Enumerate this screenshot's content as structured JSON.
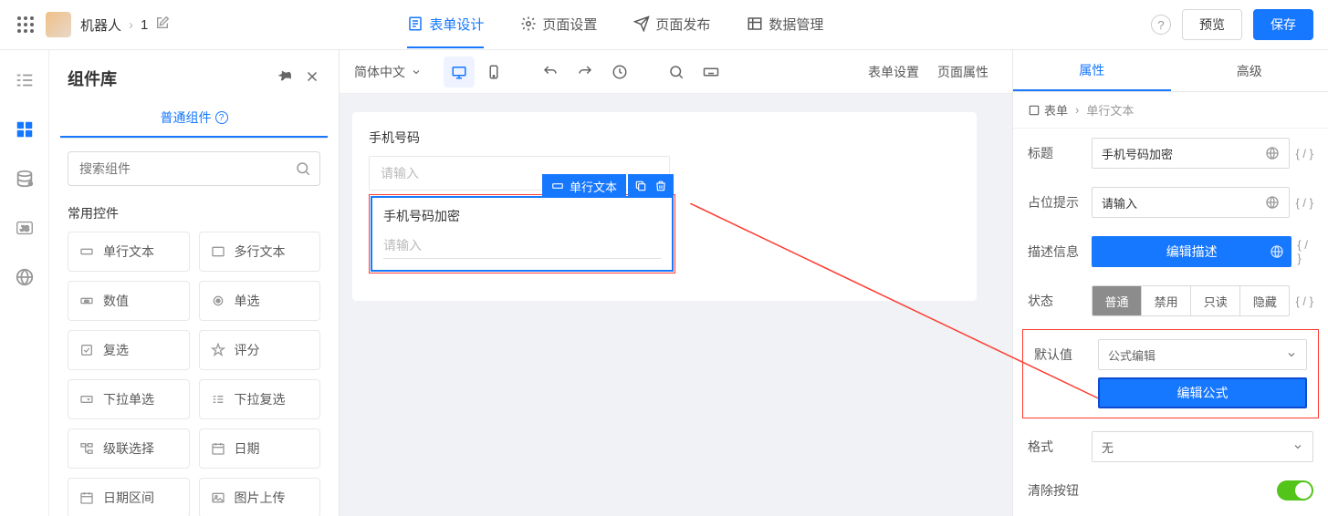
{
  "header": {
    "app_name": "机器人",
    "page_num": "1",
    "tabs": {
      "form_design": "表单设计",
      "page_settings": "页面设置",
      "page_publish": "页面发布",
      "data_manage": "数据管理"
    },
    "preview": "预览",
    "save": "保存"
  },
  "sidebar": {
    "title": "组件库",
    "tab": "普通组件",
    "search_placeholder": "搜索组件",
    "section": "常用控件",
    "widgets": [
      "单行文本",
      "多行文本",
      "数值",
      "单选",
      "复选",
      "评分",
      "下拉单选",
      "下拉复选",
      "级联选择",
      "日期",
      "日期区间",
      "图片上传"
    ]
  },
  "toolbar": {
    "language": "简体中文",
    "form_settings": "表单设置",
    "page_attrs": "页面属性"
  },
  "canvas": {
    "field1": {
      "label": "手机号码",
      "placeholder": "请输入"
    },
    "selected": {
      "chip": "单行文本",
      "label": "手机号码加密",
      "placeholder": "请输入"
    }
  },
  "props": {
    "tab_attr": "属性",
    "tab_advanced": "高级",
    "crumb_form": "表单",
    "crumb_field": "单行文本",
    "rows": {
      "title": "标题",
      "title_value": "手机号码加密",
      "placeholder": "占位提示",
      "placeholder_value": "请输入",
      "description": "描述信息",
      "edit_description": "编辑描述",
      "status": "状态",
      "status_options": [
        "普通",
        "禁用",
        "只读",
        "隐藏"
      ],
      "default": "默认值",
      "default_value": "公式编辑",
      "edit_formula": "编辑公式",
      "format": "格式",
      "format_value": "无",
      "clear_btn": "清除按钮"
    },
    "formula_suffix": "{ / }"
  }
}
